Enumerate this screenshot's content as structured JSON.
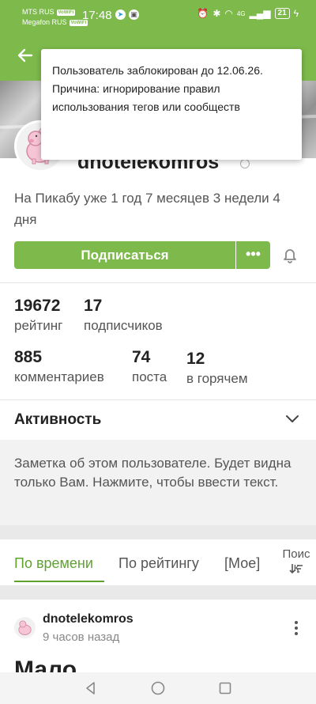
{
  "status_bar": {
    "carrier1": "MTS RUS",
    "carrier2": "Megafon RUS",
    "volte": "VoWiFi",
    "time": "17:48",
    "network": "4G",
    "battery": "21"
  },
  "tooltip": {
    "line1": "Пользователь заблокирован до 12.06.26.",
    "line2": "Причина: игнорирование правил использования тегов или сообществ"
  },
  "profile": {
    "username": "dnotelekomros",
    "member_since": "На Пикабу уже 1 год 7 месяцев 3 недели 4 дня",
    "subscribe_label": "Подписаться",
    "more_label": "•••"
  },
  "stats": {
    "rating_value": "19672",
    "rating_label": "рейтинг",
    "subscribers_value": "17",
    "subscribers_label": "подписчиков",
    "comments_value": "885",
    "comments_label": "комментариев",
    "posts_value": "74",
    "posts_label": "поста",
    "hot_value": "12",
    "hot_label": "в горячем"
  },
  "activity": {
    "label": "Активность"
  },
  "note": {
    "text": "Заметка об этом пользователе. Будет видна только Вам. Нажмите, чтобы ввести текст."
  },
  "tabs": [
    {
      "label": "По времени",
      "active": true
    },
    {
      "label": "По рейтингу",
      "active": false
    },
    {
      "label": "[Мое]",
      "active": false
    }
  ],
  "tab_search": {
    "line1": "Поис",
    "line2": "к"
  },
  "post": {
    "author": "dnotelekomros",
    "time": "9 часов назад",
    "title": "Мало"
  },
  "colors": {
    "brand_green": "#7dba4b",
    "active_tab": "#5ea330"
  }
}
